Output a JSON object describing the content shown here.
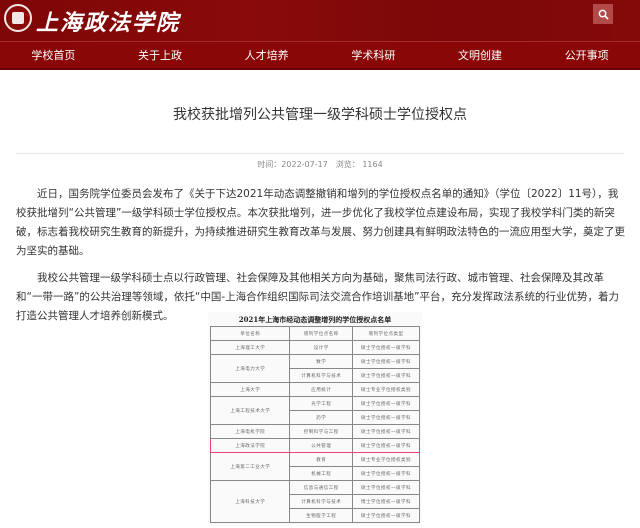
{
  "header": {
    "logo_text": "上海政法学院",
    "search_icon": "search-icon"
  },
  "nav": [
    "学校首页",
    "关于上政",
    "人才培养",
    "学术科研",
    "文明创建",
    "公开事项"
  ],
  "article": {
    "title": "我校获批增列公共管理一级学科硕士学位授权点",
    "time": "时间：2022-07-17",
    "views": "浏览： 1164",
    "paragraphs": [
      "近日，国务院学位委员会发布了《关于下达2021年动态调整撤销和增列的学位授权点名单的通知》（学位〔2022〕11号），我校获批增列“公共管理”一级学科硕士学位授权点。本次获批增列，进一步优化了我校学位点建设布局，实现了我校学科门类的新突破，标志着我校研究生教育的新提升，为持续推进研究生教育改革与发展、努力创建具有鲜明政法特色的一流应用型大学，奠定了更为坚实的基础。",
      "我校公共管理一级学科硕士点以行政管理、社会保障及其他相关方向为基础，聚焦司法行政、城市管理、社会保障及其改革和“一带一路”的公共治理等领域，依托“中国-上海合作组织国际司法交流合作培训基地”平台，充分发挥政法系统的行业优势，着力打造公共管理人才培养创新模式。"
    ]
  },
  "figure": {
    "title": "2021年上海市经动态调整增列的学位授权点名单",
    "headers": [
      "单位名称",
      "增列学位点名称",
      "增列学位点类型"
    ],
    "groups": [
      {
        "unit": "上海理工大学",
        "rows": [
          [
            "设计学",
            "硕士学位授权一级学科"
          ]
        ]
      },
      {
        "unit": "上海电力大学",
        "rows": [
          [
            "数学",
            "硕士学位授权一级学科"
          ],
          [
            "计算机科学与技术",
            "硕士学位授权一级学科"
          ]
        ]
      },
      {
        "unit": "上海大学",
        "rows": [
          [
            "应用统计",
            "硕士专业学位授权类别"
          ]
        ]
      },
      {
        "unit": "上海工程技术大学",
        "rows": [
          [
            "光学工程",
            "硕士学位授权一级学科"
          ],
          [
            "药学",
            "硕士学位授权一级学科"
          ]
        ]
      },
      {
        "unit": "上海电机学院",
        "rows": [
          [
            "控制科学与工程",
            "硕士学位授权一级学科"
          ]
        ]
      },
      {
        "unit": "上海政法学院",
        "highlight": true,
        "rows": [
          [
            "公共管理",
            "硕士学位授权一级学科"
          ]
        ]
      },
      {
        "unit": "上海第二工业大学",
        "rows": [
          [
            "教育",
            "硕士专业学位授权类别"
          ],
          [
            "机械工程",
            "硕士学位授权一级学科"
          ]
        ]
      },
      {
        "unit": "上海科技大学",
        "rows": [
          [
            "信息与通信工程",
            "硕士学位授权一级学科"
          ],
          [
            "计算机科学与技术",
            "博士学位授权一级学科"
          ],
          [
            "生物医学工程",
            "硕士学位授权一级学科"
          ]
        ]
      }
    ],
    "highlight_color": "#e8457a"
  }
}
